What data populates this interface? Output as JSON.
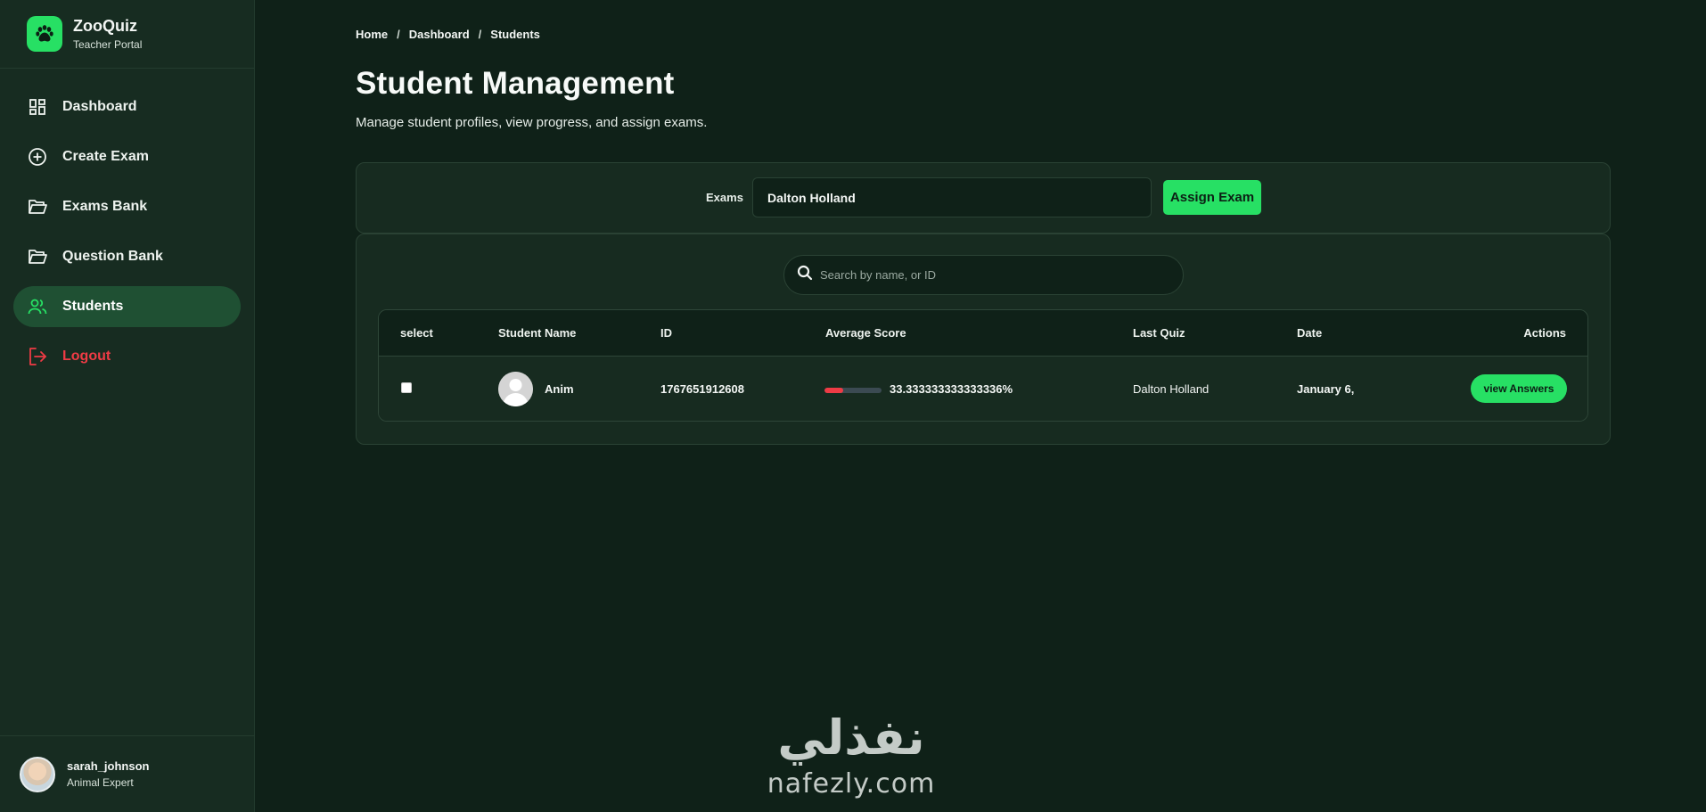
{
  "brand": {
    "title": "ZooQuiz",
    "subtitle": "Teacher Portal"
  },
  "sidebar": {
    "items": [
      {
        "label": "Dashboard",
        "icon": "dashboard-icon",
        "active": false
      },
      {
        "label": "Create Exam",
        "icon": "plus-circle-icon",
        "active": false
      },
      {
        "label": "Exams Bank",
        "icon": "folder-icon",
        "active": false
      },
      {
        "label": "Question Bank",
        "icon": "folder-icon",
        "active": false
      },
      {
        "label": "Students",
        "icon": "users-icon",
        "active": true
      },
      {
        "label": "Logout",
        "icon": "logout-icon",
        "active": false
      }
    ],
    "user": {
      "name": "sarah_johnson",
      "role": "Animal Expert"
    }
  },
  "breadcrumb": {
    "home": "Home",
    "dashboard": "Dashboard",
    "current": "Students",
    "separator": "/"
  },
  "page": {
    "title": "Student Management",
    "subtitle": "Manage student profiles, view progress, and assign exams."
  },
  "assign": {
    "label": "Exams",
    "selected_exam": "Dalton Holland",
    "button_label": "Assign Exam"
  },
  "search": {
    "placeholder": "Search by name, or ID"
  },
  "table": {
    "headers": {
      "select": "select",
      "name": "Student Name",
      "id": "ID",
      "score": "Average Score",
      "last_quiz": "Last Quiz",
      "date": "Date",
      "actions": "Actions"
    },
    "rows": [
      {
        "checked": false,
        "name": "Anim",
        "id": "1767651912608",
        "score_text": "33.333333333333336%",
        "score_fraction": 0.3333,
        "last_quiz": "Dalton Holland",
        "date": "January 6,",
        "action_label": "view Answers"
      }
    ]
  },
  "watermark": {
    "arabic": "نفذلي",
    "latin": "nafezly.com"
  },
  "colors": {
    "accent": "#27e064",
    "background": "#0f2118",
    "panel": "#172b20",
    "active_nav": "#1f5033",
    "danger": "#ef3b45"
  }
}
